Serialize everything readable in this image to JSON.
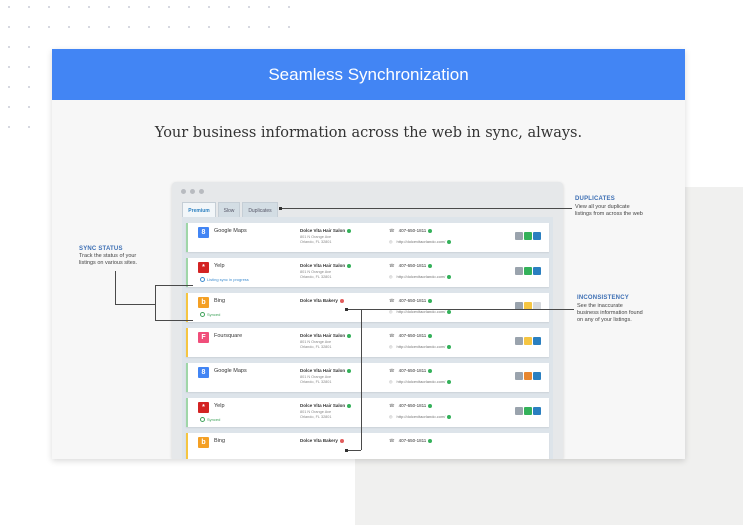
{
  "banner": {
    "title": "Seamless Synchronization"
  },
  "subtitle": "Your business information across the web in sync, always.",
  "tabs": [
    {
      "label": "Premium",
      "active": true
    },
    {
      "label": "Slow",
      "active": false
    },
    {
      "label": "Duplicates",
      "active": false
    }
  ],
  "listings": [
    {
      "site": "Google Maps",
      "logo_color": "#4285f4",
      "logo_glyph": "8",
      "sync": "",
      "business": "Dolce Vita Hair Salon",
      "status": "ok",
      "address": [
        "801 N Orange Ave",
        "Orlando, FL 32801"
      ],
      "phone": "407-650-1811",
      "url": "http://dolcevitaorlando.com/",
      "border": "green",
      "actions": [
        "#9aa3ad",
        "#34b15a",
        "#2a7fc0"
      ]
    },
    {
      "site": "Yelp",
      "logo_color": "#d32323",
      "logo_glyph": "*",
      "sync": "Listing sync in progress",
      "sync_state": "progress",
      "business": "Dolce Vita Hair Salon",
      "status": "ok",
      "address": [
        "801 N Orange Ave",
        "Orlando, FL 32801"
      ],
      "phone": "407-650-1811",
      "url": "http://dolcevitaorlando.com/",
      "border": "green",
      "actions": [
        "#9aa3ad",
        "#34b15a",
        "#2a7fc0"
      ]
    },
    {
      "site": "Bing",
      "logo_color": "#f4a025",
      "logo_glyph": "b",
      "sync": "Synced",
      "sync_state": "ok",
      "business": "Dolce Vita Bakery",
      "status": "error",
      "address": [],
      "phone": "407-650-1811",
      "url": "http://dolcevitaorlando.com/",
      "border": "yellow",
      "actions": [
        "#9aa3ad",
        "#f5c542",
        "#d6d9dd"
      ]
    },
    {
      "site": "Foursquare",
      "logo_color": "#f04e7a",
      "logo_glyph": "F",
      "sync": "",
      "business": "Dolce Vita Hair Salon",
      "status": "ok",
      "address": [
        "801 N Orange Ave",
        "Orlando, FL 32801"
      ],
      "phone": "407-650-1811",
      "url": "http://dolcevitaorlando.com/",
      "border": "yellow",
      "actions": [
        "#9aa3ad",
        "#f5c542",
        "#2a7fc0"
      ]
    },
    {
      "site": "Google Maps",
      "logo_color": "#4285f4",
      "logo_glyph": "8",
      "sync": "",
      "business": "Dolce Vita Hair Salon",
      "status": "ok",
      "address": [
        "801 N Orange Ave",
        "Orlando, FL 32801"
      ],
      "phone": "407-650-1811",
      "url": "http://dolcevitaorlando.com/",
      "border": "green",
      "actions": [
        "#9aa3ad",
        "#e8862e",
        "#2a7fc0"
      ]
    },
    {
      "site": "Yelp",
      "logo_color": "#d32323",
      "logo_glyph": "*",
      "sync": "Synced",
      "sync_state": "ok",
      "business": "Dolce Vita Hair Salon",
      "status": "ok",
      "address": [
        "801 N Orange Ave",
        "Orlando, FL 32801"
      ],
      "phone": "407-650-1811",
      "url": "http://dolcevitaorlando.com/",
      "border": "green",
      "actions": [
        "#9aa3ad",
        "#34b15a",
        "#2a7fc0"
      ]
    },
    {
      "site": "Bing",
      "logo_color": "#f4a025",
      "logo_glyph": "b",
      "sync": "",
      "business": "Dolce Vita Bakery",
      "status": "error",
      "address": [],
      "phone": "407-650-1811",
      "url": "",
      "border": "yellow",
      "actions": []
    }
  ],
  "annotations": {
    "sync_status": {
      "title": "SYNC STATUS",
      "desc": [
        "Track the status of your",
        "listings on various sites."
      ]
    },
    "duplicates": {
      "title": "DUPLICATES",
      "desc": [
        "View all your duplicate",
        "listings from across the web"
      ]
    },
    "inconsistency": {
      "title": "INCONSISTENCY",
      "desc": [
        "See the inaccurate",
        "business information found",
        "on any of your listings."
      ]
    }
  },
  "colors": {
    "banner": "#4285f4",
    "annotation_title": "#3d6fb4"
  }
}
